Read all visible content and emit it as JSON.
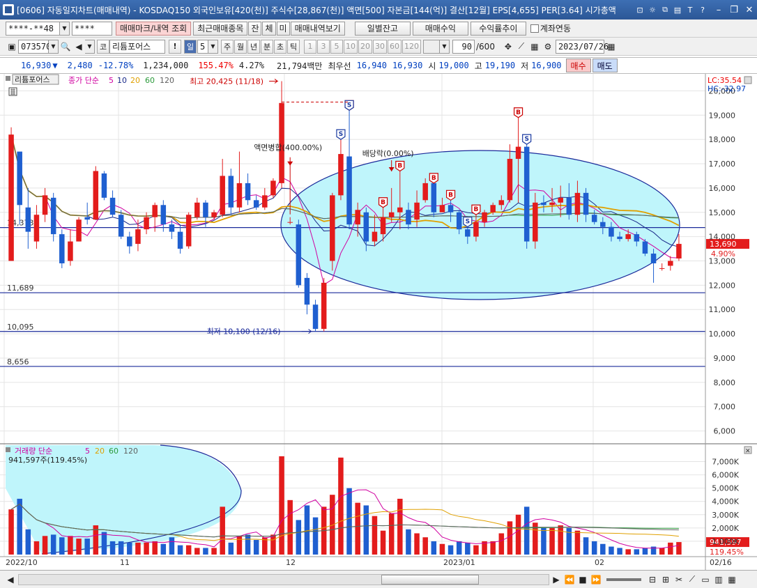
{
  "window": {
    "title": "[0606] 자동일지차트(매매내역) - KOSDAQ150 외국인보유[420(천)] 주식수[28,867(천)] 액면[500] 자본금[144(억)] 결산[12월] EPS[4,655] PER[3.64] 시가총액",
    "icons": [
      "pin-icon",
      "settings-icon",
      "window-icon",
      "print-icon",
      "font-icon",
      "help-icon"
    ],
    "controls": [
      "minimize",
      "restore",
      "close"
    ]
  },
  "toolbar1": {
    "account": "****-**48",
    "password": "****",
    "btn_mark": "매매마크/내역 조회",
    "btn_recent": "최근매매종목",
    "btn_jan": "잔",
    "btn_che": "체",
    "btn_mi": "미",
    "btn_trade_view": "매매내역보기",
    "btn_daily": "일별잔고",
    "btn_profit": "매매수익",
    "btn_rate": "수익률추이",
    "link_label": "계좌연동"
  },
  "toolbar2": {
    "code": "073570",
    "prefix": "코",
    "name": "리튬포어스",
    "excl": "!",
    "period": "일",
    "period_n": "5",
    "periods": [
      "주",
      "월",
      "년",
      "분",
      "초",
      "틱"
    ],
    "nums": [
      "1",
      "3",
      "5",
      "10",
      "20",
      "30",
      "60",
      "120"
    ],
    "count": "90",
    "total": "/600",
    "date": "2023/07/26"
  },
  "quote": {
    "price": "16,930",
    "change": "2,480",
    "pct": "-12.78%",
    "volume": "1,234,000",
    "vol_pct": "155.47%",
    "turnover": "4.27%",
    "amount": "21,794백만",
    "pref_label": "최우선",
    "ask": "16,940",
    "bid": "16,930",
    "open_label": "시",
    "open": "19,000",
    "high_label": "고",
    "high": "19,190",
    "low_label": "저",
    "low": "16,900",
    "buy": "매수",
    "sell": "매도"
  },
  "price_panel": {
    "legend_name": "리튬포어스",
    "legend_series": "종가 단순",
    "ma_labels": [
      "5",
      "10",
      "20",
      "60",
      "120"
    ],
    "ma_colors": [
      "#d000a0",
      "#1a2a8a",
      "#e0a000",
      "#2a9a3a",
      "#606060"
    ],
    "high_note": "최고 20,425 (11/18)",
    "low_note": "최저 10,100 (12/16)",
    "split_note": "액면병합(400.00%)",
    "div_note": "배당락(0.00%)",
    "lc": "LC:35.54",
    "hc": "HC:-32.97",
    "hlines": [
      "14,373",
      "11,689",
      "10,095",
      "8,656"
    ],
    "last_price": "13,690",
    "last_pct": "4.90%"
  },
  "volume_panel": {
    "legend_series": "거래량 단순",
    "ma_labels": [
      "5",
      "20",
      "60",
      "120"
    ],
    "stat": "941,597주(119.45%)",
    "last": "941,597",
    "last_pct": "119.45%"
  },
  "chart_data": {
    "type": "candlestick",
    "x_labels": [
      "2022/10",
      "11",
      "12",
      "2023/01",
      "02",
      "02/16"
    ],
    "price_axis": [
      "20,000",
      "19,000",
      "18,000",
      "17,000",
      "16,000",
      "15,000",
      "14,000",
      "13,000",
      "12,000",
      "11,000",
      "10,000",
      "9,000",
      "8,000",
      "7,000",
      "6,000"
    ],
    "volume_axis": [
      "7,000K",
      "6,000K",
      "5,000K",
      "4,000K",
      "3,000K",
      "2,000K",
      "1,000K"
    ],
    "ylim_price": [
      5500,
      20700
    ],
    "ylim_volume": [
      0,
      7500
    ],
    "candles": [
      [
        13000,
        18200,
        18500,
        13000,
        3400
      ],
      [
        17500,
        15300,
        17000,
        14500,
        4200
      ],
      [
        15200,
        14200,
        16000,
        13500,
        1900
      ],
      [
        13800,
        14900,
        15300,
        13500,
        1000
      ],
      [
        14900,
        15700,
        16000,
        14600,
        1400
      ],
      [
        15600,
        14100,
        15800,
        13800,
        1500
      ],
      [
        14100,
        12900,
        14300,
        12700,
        1300
      ],
      [
        13000,
        13800,
        14300,
        12800,
        1400
      ],
      [
        13800,
        14700,
        14800,
        13800,
        1200
      ],
      [
        14800,
        14700,
        15400,
        14500,
        1200
      ],
      [
        14700,
        16700,
        16900,
        14700,
        2200
      ],
      [
        16600,
        15600,
        16700,
        15500,
        1700
      ],
      [
        15600,
        14900,
        15900,
        14800,
        1000
      ],
      [
        14900,
        14000,
        15100,
        13900,
        1000
      ],
      [
        14000,
        13600,
        14200,
        13300,
        900
      ],
      [
        13700,
        14300,
        14700,
        13400,
        900
      ],
      [
        14300,
        14800,
        15000,
        14100,
        900
      ],
      [
        14800,
        15300,
        15400,
        14200,
        1000
      ],
      [
        15300,
        14500,
        15500,
        14200,
        800
      ],
      [
        14500,
        14200,
        14700,
        13900,
        1300
      ],
      [
        14200,
        13500,
        14500,
        13300,
        700
      ],
      [
        13600,
        14900,
        15000,
        13500,
        700
      ],
      [
        14800,
        15400,
        15600,
        14700,
        500
      ],
      [
        15400,
        14800,
        15500,
        14400,
        500
      ],
      [
        14800,
        15000,
        15100,
        14700,
        500
      ],
      [
        14900,
        16500,
        17200,
        14800,
        3600
      ],
      [
        16500,
        15200,
        16800,
        14900,
        900
      ],
      [
        15200,
        16200,
        17500,
        15000,
        1400
      ],
      [
        16200,
        15500,
        16600,
        15300,
        1500
      ],
      [
        15500,
        15200,
        15700,
        15100,
        1100
      ],
      [
        15200,
        15700,
        16000,
        15100,
        1300
      ],
      [
        15700,
        16300,
        16400,
        15600,
        1500
      ],
      [
        16200,
        19500,
        20400,
        16000,
        7400
      ],
      [
        14600,
        14600,
        14800,
        14500,
        4100
      ],
      [
        14500,
        12000,
        14700,
        11900,
        2600
      ],
      [
        12300,
        11200,
        12500,
        10800,
        3700
      ],
      [
        11200,
        10200,
        11400,
        10100,
        2800
      ],
      [
        10200,
        12100,
        12300,
        10100,
        3600
      ],
      [
        13000,
        15700,
        15800,
        12600,
        4500
      ],
      [
        15700,
        17400,
        18000,
        15500,
        7300
      ],
      [
        17300,
        14500,
        19200,
        14300,
        5000
      ],
      [
        14500,
        15100,
        15400,
        14000,
        3900
      ],
      [
        15000,
        13800,
        15200,
        13400,
        3700
      ],
      [
        13800,
        14200,
        14900,
        13600,
        2900
      ],
      [
        14100,
        14800,
        15200,
        13800,
        1800
      ],
      [
        14800,
        15000,
        16000,
        14600,
        3100
      ],
      [
        15000,
        15200,
        16700,
        14300,
        4200
      ],
      [
        15100,
        14500,
        15400,
        14300,
        1900
      ],
      [
        14700,
        15400,
        15900,
        14400,
        1600
      ],
      [
        15500,
        16200,
        16400,
        15400,
        1300
      ],
      [
        16200,
        15000,
        16200,
        14800,
        1000
      ],
      [
        15000,
        15300,
        15600,
        15000,
        800
      ],
      [
        15300,
        15000,
        15500,
        14600,
        700
      ],
      [
        15000,
        14300,
        15100,
        14100,
        1000
      ],
      [
        14300,
        14000,
        14400,
        13700,
        900
      ],
      [
        14000,
        14600,
        14900,
        13800,
        700
      ],
      [
        14600,
        15000,
        15100,
        14400,
        1000
      ],
      [
        15000,
        15300,
        15400,
        14900,
        1000
      ],
      [
        15300,
        15500,
        15700,
        15100,
        1600
      ],
      [
        15500,
        17200,
        17800,
        15400,
        2500
      ],
      [
        17200,
        17700,
        18900,
        15400,
        3000
      ],
      [
        17700,
        13800,
        17800,
        13500,
        3600
      ],
      [
        13800,
        15400,
        15800,
        13500,
        2400
      ],
      [
        15400,
        15300,
        15700,
        15000,
        2000
      ],
      [
        15300,
        15400,
        16000,
        15000,
        2000
      ],
      [
        15400,
        15600,
        16100,
        14800,
        2200
      ],
      [
        15600,
        14900,
        16200,
        14700,
        2000
      ],
      [
        14900,
        15800,
        16300,
        14600,
        1800
      ],
      [
        15800,
        14900,
        16000,
        14600,
        1300
      ],
      [
        14900,
        14600,
        15100,
        14500,
        1000
      ],
      [
        14600,
        14400,
        14800,
        14100,
        800
      ],
      [
        14400,
        14000,
        14600,
        13800,
        600
      ],
      [
        14000,
        13900,
        14200,
        13800,
        500
      ],
      [
        13900,
        14100,
        14300,
        13800,
        400
      ],
      [
        14100,
        13800,
        14200,
        13600,
        400
      ],
      [
        13800,
        13300,
        13900,
        13200,
        500
      ],
      [
        13300,
        12900,
        13500,
        12100,
        600
      ],
      [
        12700,
        12700,
        12900,
        12600,
        500
      ],
      [
        12800,
        13000,
        13200,
        12600,
        900
      ],
      [
        13100,
        13700,
        14100,
        13000,
        940
      ]
    ],
    "split_index": 33,
    "signals": [
      {
        "i": 40,
        "type": "B"
      },
      {
        "i": 39,
        "type": "S"
      },
      {
        "i": 40,
        "type": "S"
      },
      {
        "i": 44,
        "type": "B"
      },
      {
        "i": 46,
        "type": "B"
      },
      {
        "i": 50,
        "type": "B"
      },
      {
        "i": 52,
        "type": "B"
      },
      {
        "i": 54,
        "type": "S"
      },
      {
        "i": 55,
        "type": "B"
      },
      {
        "i": 60,
        "type": "B"
      },
      {
        "i": 61,
        "type": "S"
      }
    ]
  }
}
